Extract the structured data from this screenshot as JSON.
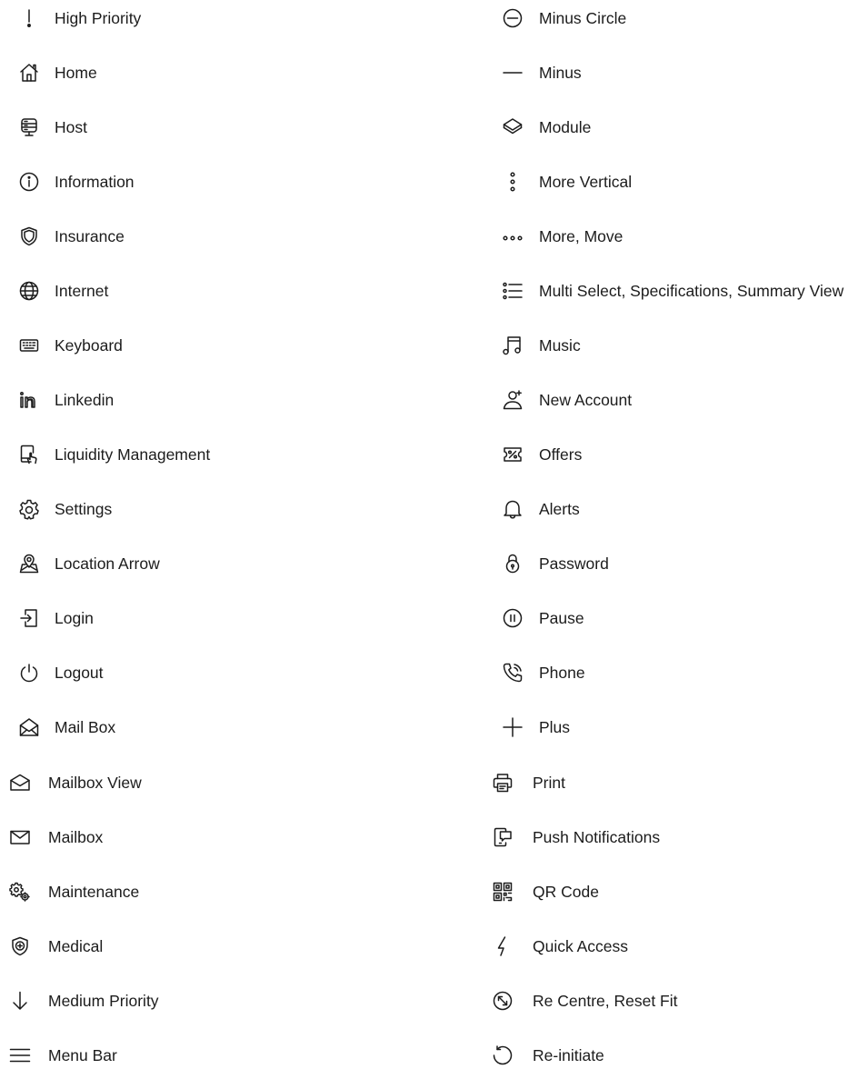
{
  "left_column": [
    {
      "label": "High Priority",
      "icon": "high-priority-icon"
    },
    {
      "label": "Home",
      "icon": "home-icon"
    },
    {
      "label": "Host",
      "icon": "host-icon"
    },
    {
      "label": "Information",
      "icon": "information-icon"
    },
    {
      "label": "Insurance",
      "icon": "insurance-icon"
    },
    {
      "label": "Internet",
      "icon": "internet-icon"
    },
    {
      "label": "Keyboard",
      "icon": "keyboard-icon"
    },
    {
      "label": "Linkedin",
      "icon": "linkedin-icon"
    },
    {
      "label": "Liquidity Management",
      "icon": "liquidity-management-icon"
    },
    {
      "label": "Settings",
      "icon": "settings-icon"
    },
    {
      "label": "Location Arrow",
      "icon": "location-arrow-icon"
    },
    {
      "label": "Login",
      "icon": "login-icon"
    },
    {
      "label": "Logout",
      "icon": "logout-icon"
    },
    {
      "label": "Mail Box",
      "icon": "mail-box-icon"
    },
    {
      "label": "Mailbox View",
      "icon": "mailbox-view-icon"
    },
    {
      "label": "Mailbox",
      "icon": "mailbox-icon"
    },
    {
      "label": "Maintenance",
      "icon": "maintenance-icon"
    },
    {
      "label": "Medical",
      "icon": "medical-icon"
    },
    {
      "label": "Medium Priority",
      "icon": "medium-priority-icon"
    },
    {
      "label": "Menu Bar",
      "icon": "menu-bar-icon"
    }
  ],
  "right_column": [
    {
      "label": "Minus Circle",
      "icon": "minus-circle-icon"
    },
    {
      "label": "Minus",
      "icon": "minus-icon"
    },
    {
      "label": "Module",
      "icon": "module-icon"
    },
    {
      "label": "More Vertical",
      "icon": "more-vertical-icon"
    },
    {
      "label": "More, Move",
      "icon": "more-move-icon"
    },
    {
      "label": "Multi Select, Specifications, Summary View",
      "icon": "multi-select-icon"
    },
    {
      "label": "Music",
      "icon": "music-icon"
    },
    {
      "label": "New Account",
      "icon": "new-account-icon"
    },
    {
      "label": "Offers",
      "icon": "offers-icon"
    },
    {
      "label": "Alerts",
      "icon": "alerts-icon"
    },
    {
      "label": "Password",
      "icon": "password-icon"
    },
    {
      "label": "Pause",
      "icon": "pause-icon"
    },
    {
      "label": "Phone",
      "icon": "phone-icon"
    },
    {
      "label": "Plus",
      "icon": "plus-icon"
    },
    {
      "label": "Print",
      "icon": "print-icon"
    },
    {
      "label": "Push Notifications",
      "icon": "push-notifications-icon"
    },
    {
      "label": "QR Code",
      "icon": "qr-code-icon"
    },
    {
      "label": "Quick Access",
      "icon": "quick-access-icon"
    },
    {
      "label": "Re Centre, Reset Fit",
      "icon": "re-centre-icon"
    },
    {
      "label": "Re-initiate",
      "icon": "re-initiate-icon"
    }
  ]
}
